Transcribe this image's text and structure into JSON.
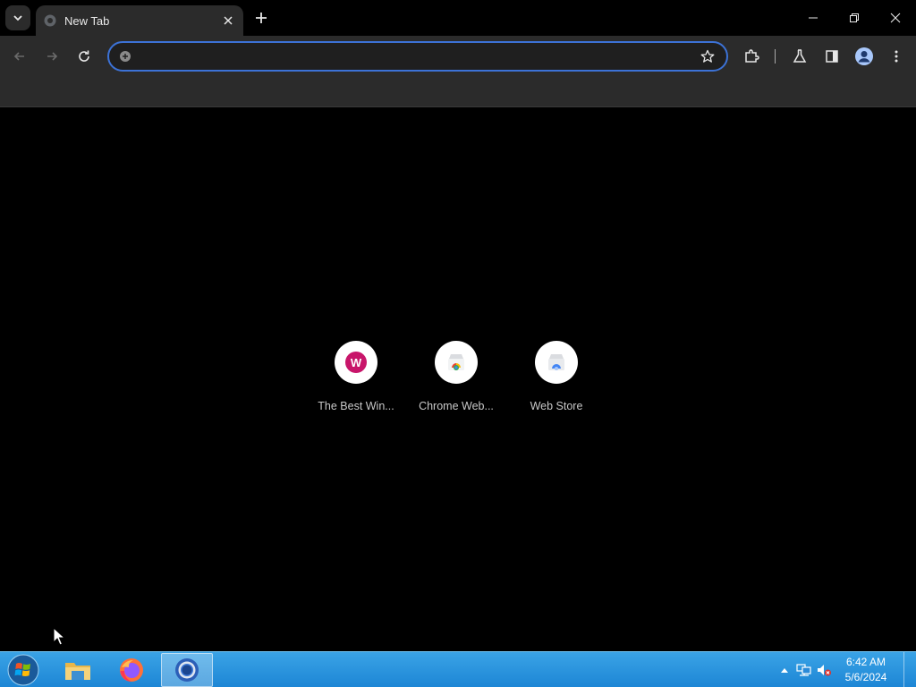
{
  "browser": {
    "tab": {
      "title": "New Tab"
    },
    "omnibox": {
      "value": "",
      "placeholder": ""
    }
  },
  "shortcuts": [
    {
      "label": "The Best Win...",
      "badge": "W",
      "icon": "w-icon"
    },
    {
      "label": "Chrome Web...",
      "icon": "chrome-web-store-icon"
    },
    {
      "label": "Web Store",
      "icon": "web-store-icon"
    }
  ],
  "taskbar": {
    "clock": {
      "time": "6:42 AM",
      "date": "5/6/2024"
    },
    "apps": [
      "file-explorer-icon",
      "firefox-icon",
      "chrome-icon"
    ]
  },
  "colors": {
    "focus_ring": "#3c72d6",
    "toolbar": "#2b2b2b",
    "w_badge": "#c8156a"
  }
}
